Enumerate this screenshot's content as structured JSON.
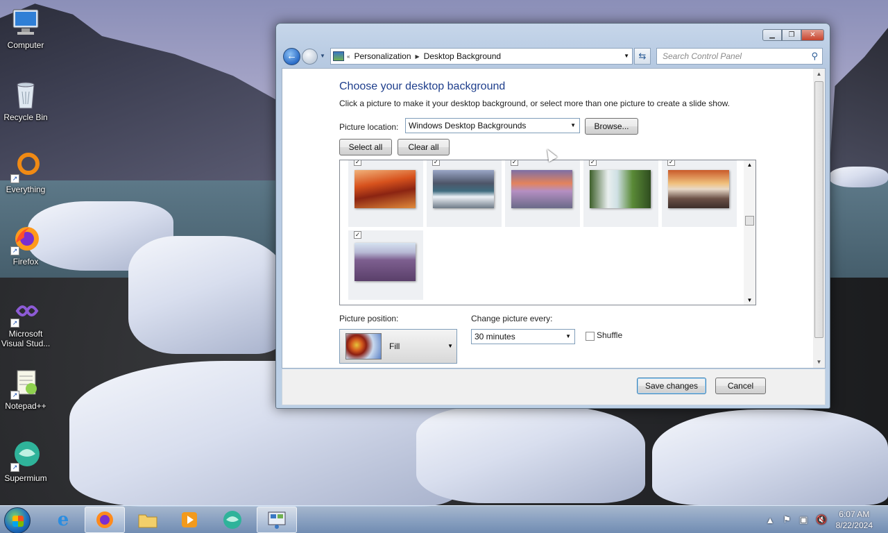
{
  "desktop": {
    "icons": [
      {
        "label": "Computer"
      },
      {
        "label": "Recycle Bin"
      },
      {
        "label": "Everything"
      },
      {
        "label": "Firefox"
      },
      {
        "label": "Microsoft Visual Stud..."
      },
      {
        "label": "Notepad++"
      },
      {
        "label": "Supermium"
      }
    ]
  },
  "window": {
    "breadcrumb": [
      "Personalization",
      "Desktop Background"
    ],
    "search_placeholder": "Search Control Panel",
    "heading": "Choose your desktop background",
    "description": "Click a picture to make it your desktop background, or select more than one picture to create a slide show.",
    "picture_location_label": "Picture location:",
    "picture_location_value": "Windows Desktop Backgrounds",
    "browse_label": "Browse...",
    "select_all_label": "Select all",
    "clear_all_label": "Clear all",
    "picture_position_label": "Picture position:",
    "picture_position_value": "Fill",
    "change_picture_label": "Change picture every:",
    "change_picture_value": "30 minutes",
    "shuffle_label": "Shuffle",
    "shuffle_checked": false,
    "save_label": "Save changes",
    "cancel_label": "Cancel",
    "thumbnails": [
      {
        "checked": true,
        "check_glyph": "✓"
      },
      {
        "checked": true,
        "check_glyph": "✓"
      },
      {
        "checked": true,
        "check_glyph": "✓"
      },
      {
        "checked": true,
        "check_glyph": "✓"
      },
      {
        "checked": true,
        "check_glyph": "✓"
      },
      {
        "checked": true,
        "check_glyph": "✓"
      }
    ]
  },
  "taskbar": {
    "time": "6:07 AM",
    "date": "8/22/2024"
  }
}
